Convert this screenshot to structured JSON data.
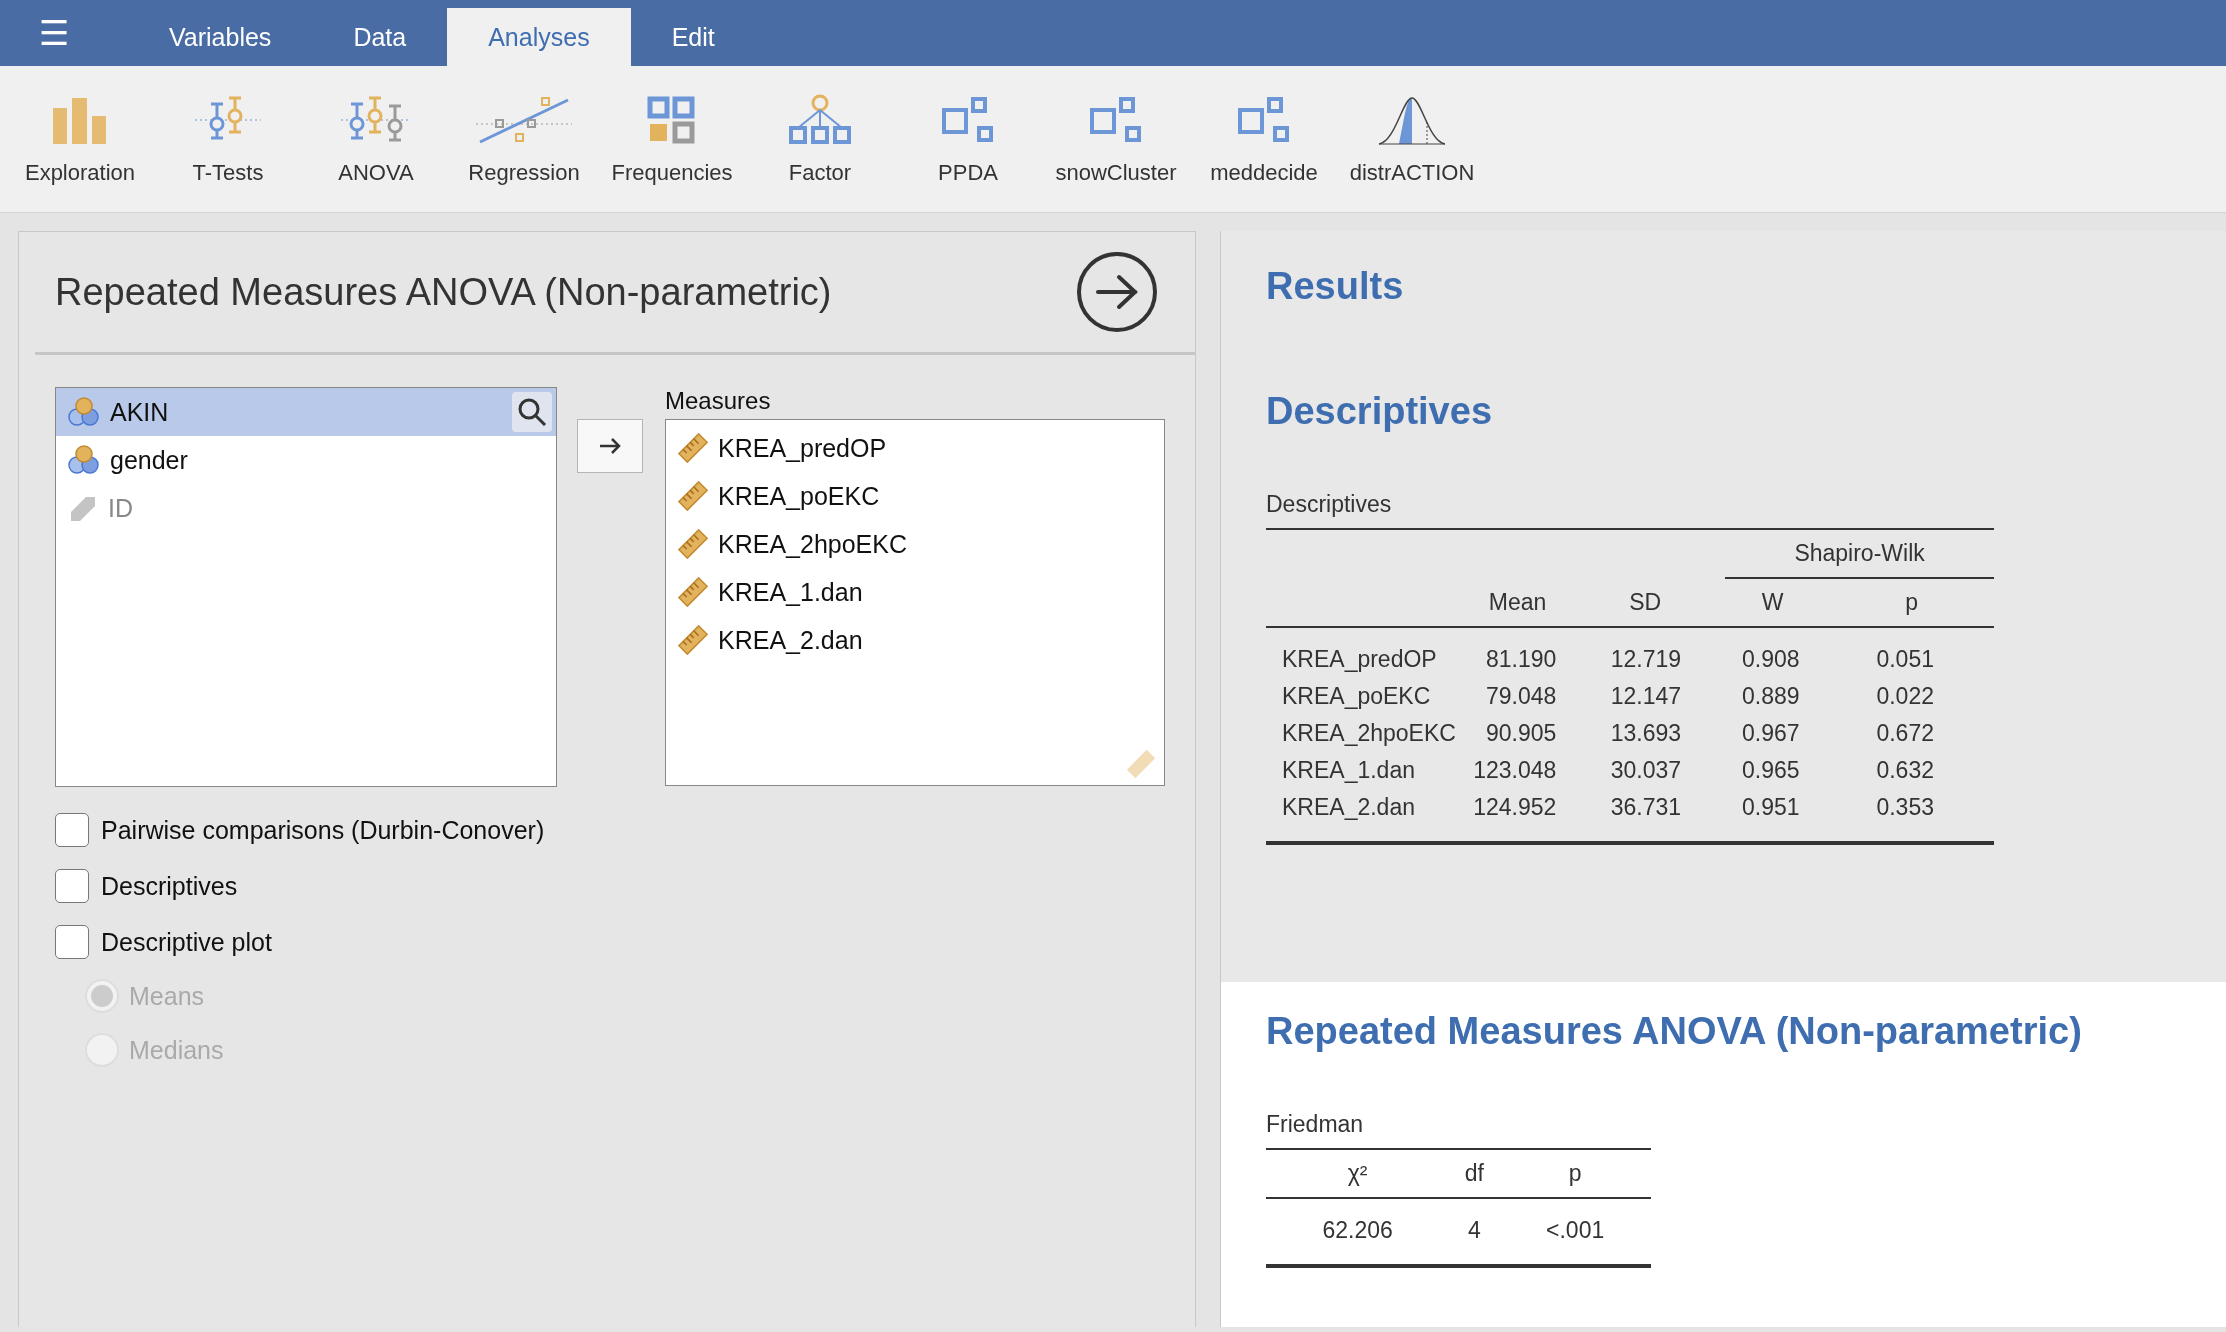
{
  "menu": {
    "icon": "☰"
  },
  "tabs": [
    {
      "label": "Variables",
      "selected": false
    },
    {
      "label": "Data",
      "selected": false
    },
    {
      "label": "Analyses",
      "selected": true
    },
    {
      "label": "Edit",
      "selected": false
    }
  ],
  "toolbar": [
    {
      "label": "Exploration",
      "kind": "bars"
    },
    {
      "label": "T-Tests",
      "kind": "ttest"
    },
    {
      "label": "ANOVA",
      "kind": "anova"
    },
    {
      "label": "Regression",
      "kind": "regression"
    },
    {
      "label": "Frequencies",
      "kind": "grid"
    },
    {
      "label": "Factor",
      "kind": "tree"
    },
    {
      "label": "PPDA",
      "kind": "module"
    },
    {
      "label": "snowCluster",
      "kind": "module"
    },
    {
      "label": "meddecide",
      "kind": "module"
    },
    {
      "label": "distrACTION",
      "kind": "curve"
    }
  ],
  "options_panel": {
    "title": "Repeated Measures ANOVA (Non-parametric)",
    "variables": [
      {
        "name": "AKIN",
        "kind": "nominal",
        "selected": true
      },
      {
        "name": "gender",
        "kind": "nominal",
        "selected": false
      },
      {
        "name": "ID",
        "kind": "id",
        "selected": false
      }
    ],
    "measures_label": "Measures",
    "measures": [
      {
        "name": "KREA_predOP",
        "kind": "continuous"
      },
      {
        "name": "KREA_poEKC",
        "kind": "continuous"
      },
      {
        "name": "KREA_2hpoEKC",
        "kind": "continuous"
      },
      {
        "name": "KREA_1.dan",
        "kind": "continuous"
      },
      {
        "name": "KREA_2.dan",
        "kind": "continuous"
      }
    ],
    "checkboxes": [
      {
        "label": "Pairwise comparisons (Durbin-Conover)",
        "checked": false
      },
      {
        "label": "Descriptives",
        "checked": false
      },
      {
        "label": "Descriptive plot",
        "checked": false
      }
    ],
    "radios": [
      {
        "label": "Means",
        "selected": true,
        "disabled": true
      },
      {
        "label": "Medians",
        "selected": false,
        "disabled": true
      }
    ]
  },
  "results": {
    "title": "Results",
    "descriptives": {
      "heading": "Descriptives",
      "table_title": "Descriptives",
      "group_header": "Shapiro-Wilk",
      "columns": [
        "",
        "Mean",
        "SD",
        "W",
        "p"
      ],
      "rows": [
        [
          "KREA_predOP",
          "81.190",
          "12.719",
          "0.908",
          "0.051"
        ],
        [
          "KREA_poEKC",
          "79.048",
          "12.147",
          "0.889",
          "0.022"
        ],
        [
          "KREA_2hpoEKC",
          "90.905",
          "13.693",
          "0.967",
          "0.672"
        ],
        [
          "KREA_1.dan",
          "123.048",
          "30.037",
          "0.965",
          "0.632"
        ],
        [
          "KREA_2.dan",
          "124.952",
          "36.731",
          "0.951",
          "0.353"
        ]
      ]
    },
    "anova": {
      "heading": "Repeated Measures ANOVA (Non-parametric)",
      "table_title": "Friedman",
      "columns": [
        "χ²",
        "df",
        "p"
      ],
      "rows": [
        [
          "62.206",
          "4",
          "<.001"
        ]
      ]
    }
  }
}
